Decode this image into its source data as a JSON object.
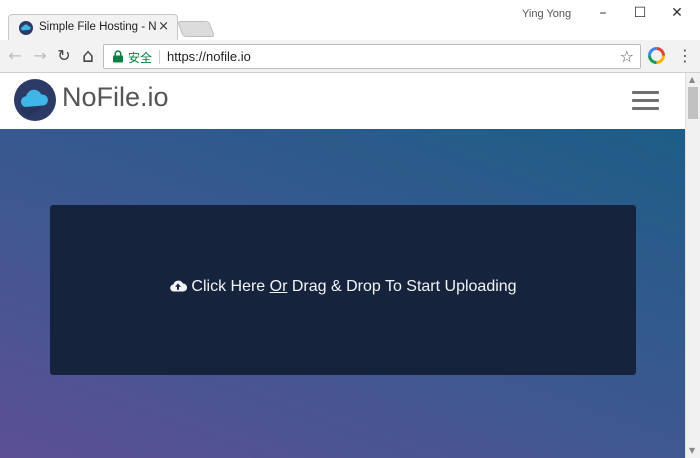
{
  "browser": {
    "tab": {
      "title": "Simple File Hosting - No",
      "close": "×"
    },
    "user_name": "Ying Yong",
    "window_controls": {
      "minimize": "–",
      "maximize": "☐",
      "close": "✕"
    },
    "nav": {
      "back": "←",
      "forward": "→",
      "reload": "↻",
      "home": "⌂"
    },
    "address": {
      "secure_label": "安全",
      "url": "https://nofile.io"
    },
    "bookmark_icon": "star-icon",
    "menu_icon": "⋮",
    "colors": {
      "secure_green": "#0b8043"
    }
  },
  "site": {
    "brand": "NoFile.io",
    "logo_icon": "cloud-icon",
    "menu_icon": "hamburger-menu-icon",
    "upload": {
      "icon": "cloud-upload-icon",
      "text_before": "Click Here ",
      "text_or": "Or",
      "text_after": " Drag & Drop To Start Uploading"
    },
    "colors": {
      "hero_gradient_start": "#5c4f96",
      "hero_gradient_end": "#1d5d86",
      "upload_box": "#16233c",
      "logo_circle": "#2c3a66",
      "logo_cloud": "#3fb5e8"
    }
  }
}
